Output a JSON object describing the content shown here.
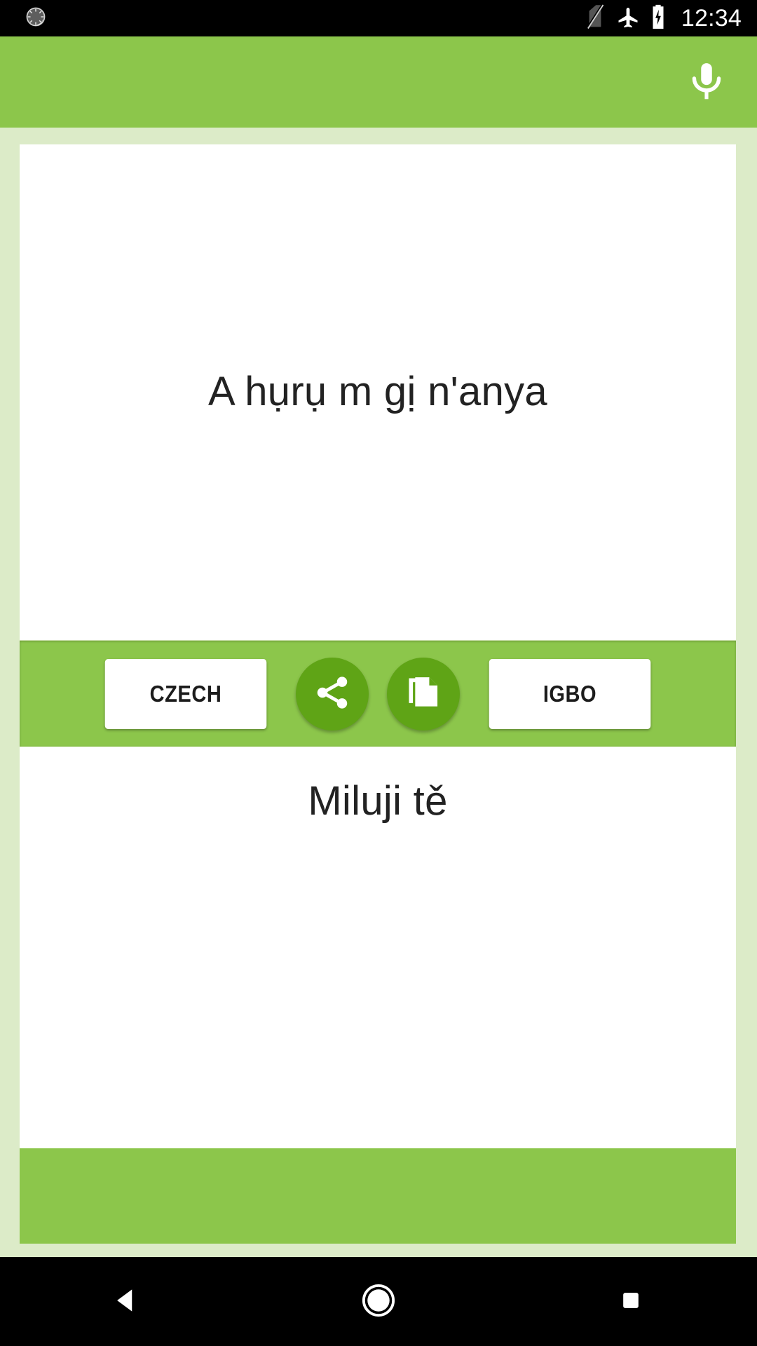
{
  "status_bar": {
    "notification_icon": "sync-circle-icon",
    "no_sim_icon": "no-sim-icon",
    "airplane_icon": "airplane-mode-icon",
    "battery_icon": "battery-charging-icon",
    "clock": "12:34"
  },
  "app_bar": {
    "mic_icon": "microphone-icon",
    "background_color": "#8cc64b"
  },
  "translation": {
    "source_text": "A hụrụ m gị n'anya",
    "target_text": "Miluji tě"
  },
  "lang_bar": {
    "left_language": "CZECH",
    "right_language": "IGBO",
    "share_icon": "share-icon",
    "copy_icon": "copy-icon",
    "button_color": "#5fa416",
    "bar_color": "#8cc64b"
  },
  "nav_bar": {
    "back": "back-triangle",
    "home": "home-circle",
    "recents": "recents-square"
  },
  "colors": {
    "accent": "#8cc64b",
    "accent_dark": "#5fa416",
    "page_background": "#dcebc8",
    "card": "#ffffff",
    "text": "#222222"
  }
}
